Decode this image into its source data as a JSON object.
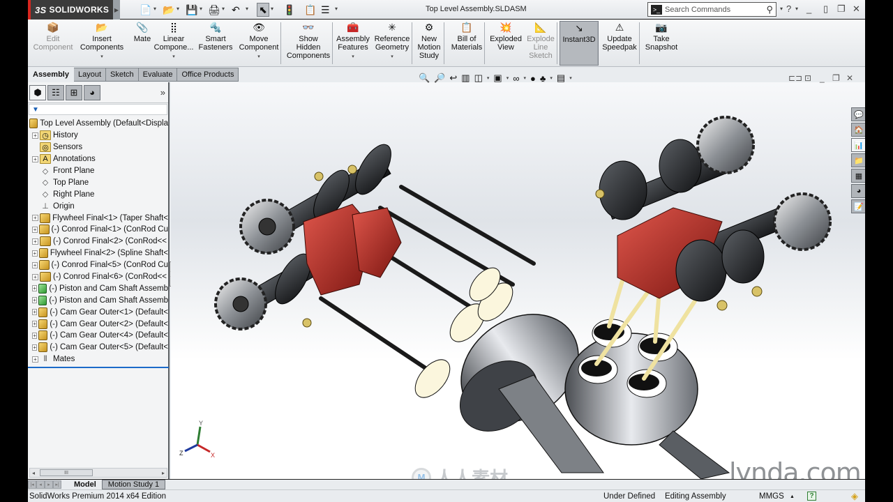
{
  "app": {
    "brand": "SOLIDWORKS",
    "document_title": "Top Level Assembly.SLDASM",
    "search": {
      "placeholder": "Search Commands"
    }
  },
  "quick_access": [
    {
      "name": "new-document",
      "icon": "📄"
    },
    {
      "name": "open-document",
      "icon": "📂"
    },
    {
      "name": "save",
      "icon": "💾"
    },
    {
      "name": "print",
      "icon": "🖨"
    },
    {
      "name": "undo",
      "icon": "↶"
    },
    {
      "name": "select",
      "icon": "⬉"
    },
    {
      "name": "rebuild",
      "icon": "🚦"
    },
    {
      "name": "file-properties",
      "icon": "📋"
    },
    {
      "name": "options",
      "icon": "☰"
    }
  ],
  "window_controls": {
    "help": "?",
    "minimize": "_",
    "tile": "▯",
    "restore": "❐",
    "close": "✕"
  },
  "command_manager": {
    "buttons": [
      {
        "id": "edit-component",
        "label": "Edit\nComponent",
        "icon": "📦",
        "disabled": true
      },
      {
        "id": "insert-components",
        "label": "Insert\nComponents",
        "icon": "📂",
        "dropdown": true
      },
      {
        "id": "mate",
        "label": "Mate",
        "icon": "📎"
      },
      {
        "id": "linear-component-pattern",
        "label": "Linear\nCompone...",
        "icon": "⣿",
        "dropdown": true
      },
      {
        "id": "smart-fasteners",
        "label": "Smart\nFasteners",
        "icon": "🔩"
      },
      {
        "id": "move-component",
        "label": "Move\nComponent",
        "icon": "👁",
        "dropdown": true
      },
      {
        "id": "show-hidden-components",
        "label": "Show\nHidden\nComponents",
        "icon": "👓"
      },
      {
        "id": "assembly-features",
        "label": "Assembly\nFeatures",
        "icon": "🧰",
        "dropdown": true
      },
      {
        "id": "reference-geometry",
        "label": "Reference\nGeometry",
        "icon": "✳",
        "dropdown": true
      },
      {
        "id": "new-motion-study",
        "label": "New\nMotion\nStudy",
        "icon": "⚙"
      },
      {
        "id": "bill-of-materials",
        "label": "Bill of\nMaterials",
        "icon": "📋"
      },
      {
        "id": "exploded-view",
        "label": "Exploded\nView",
        "icon": "💥"
      },
      {
        "id": "explode-line-sketch",
        "label": "Explode\nLine\nSketch",
        "icon": "📐",
        "disabled": true
      },
      {
        "id": "instant3d",
        "label": "Instant3D",
        "icon": "↘",
        "active": true
      },
      {
        "id": "update-speedpak",
        "label": "Update\nSpeedpak",
        "icon": "⚠"
      },
      {
        "id": "take-snapshot",
        "label": "Take\nSnapshot",
        "icon": "📷"
      }
    ],
    "tabs": [
      "Assembly",
      "Layout",
      "Sketch",
      "Evaluate",
      "Office Products"
    ],
    "active_tab": "Assembly"
  },
  "heads_up_toolbar": [
    {
      "name": "zoom-to-fit",
      "icon": "🔍"
    },
    {
      "name": "zoom-to-area",
      "icon": "🔎"
    },
    {
      "name": "previous-view",
      "icon": "↩"
    },
    {
      "name": "section-view",
      "icon": "▥"
    },
    {
      "name": "view-orientation",
      "icon": "◫",
      "dropdown": true
    },
    {
      "name": "display-style",
      "icon": "▣",
      "dropdown": true
    },
    {
      "name": "hide-show-items",
      "icon": "∞",
      "dropdown": true
    },
    {
      "name": "edit-appearance",
      "icon": "●"
    },
    {
      "name": "apply-scene",
      "icon": "♣",
      "dropdown": true
    },
    {
      "name": "view-settings",
      "icon": "▤",
      "dropdown": true
    }
  ],
  "feature_manager": {
    "tabs": [
      {
        "name": "featuremanager-tab",
        "icon": "⬢"
      },
      {
        "name": "propertymanager-tab",
        "icon": "☷"
      },
      {
        "name": "configurationmanager-tab",
        "icon": "⊞"
      },
      {
        "name": "displaymanager-tab",
        "icon": "◕"
      }
    ],
    "more": "»",
    "filter_icon": "▼",
    "tree": [
      {
        "label": "Top Level Assembly  (Default<Displa",
        "icon": "asm",
        "expander": false,
        "level": 0
      },
      {
        "label": "History",
        "icon": "history",
        "expander": true,
        "level": 1
      },
      {
        "label": "Sensors",
        "icon": "sensor",
        "expander": false,
        "level": 1
      },
      {
        "label": "Annotations",
        "icon": "annotation",
        "expander": true,
        "level": 1
      },
      {
        "label": "Front Plane",
        "icon": "plane",
        "expander": false,
        "level": 1
      },
      {
        "label": "Top Plane",
        "icon": "plane",
        "expander": false,
        "level": 1
      },
      {
        "label": "Right Plane",
        "icon": "plane",
        "expander": false,
        "level": 1
      },
      {
        "label": "Origin",
        "icon": "origin",
        "expander": false,
        "level": 1
      },
      {
        "label": "Flywheel Final<1> (Taper Shaft<",
        "icon": "asm",
        "expander": true,
        "level": 1
      },
      {
        "label": "(-) Conrod Final<1> (ConRod Cu",
        "icon": "asm",
        "expander": true,
        "level": 1
      },
      {
        "label": "(-) Conrod Final<2> (ConRod<<",
        "icon": "asm",
        "expander": true,
        "level": 1
      },
      {
        "label": "Flywheel Final<2> (Spline Shaft<",
        "icon": "asm",
        "expander": true,
        "level": 1
      },
      {
        "label": "(-) Conrod Final<5> (ConRod Cu",
        "icon": "asm",
        "expander": true,
        "level": 1
      },
      {
        "label": "(-) Conrod Final<6> (ConRod<<",
        "icon": "asm",
        "expander": true,
        "level": 1
      },
      {
        "label": "(-) Piston and Cam Shaft Assemb",
        "icon": "asm-green",
        "expander": true,
        "level": 1
      },
      {
        "label": "(-) Piston and Cam Shaft Assemb",
        "icon": "asm-green",
        "expander": true,
        "level": 1
      },
      {
        "label": "(-) Cam Gear Outer<1> (Default<",
        "icon": "asm",
        "expander": true,
        "level": 1
      },
      {
        "label": "(-) Cam Gear Outer<2> (Default<",
        "icon": "asm",
        "expander": true,
        "level": 1
      },
      {
        "label": "(-) Cam Gear Outer<4> (Default<",
        "icon": "asm",
        "expander": true,
        "level": 1
      },
      {
        "label": "(-) Cam Gear Outer<5> (Default<",
        "icon": "asm",
        "expander": true,
        "level": 1
      },
      {
        "label": "Mates",
        "icon": "mates",
        "expander": true,
        "level": 1
      }
    ],
    "hscroll_thumb": "III"
  },
  "task_pane": [
    {
      "name": "solidworks-resources",
      "icon": "💬"
    },
    {
      "name": "design-library",
      "icon": "🏠"
    },
    {
      "name": "file-explorer",
      "icon": "📊",
      "active": true
    },
    {
      "name": "view-palette",
      "icon": "📁"
    },
    {
      "name": "appearances-scenes",
      "icon": "▦"
    },
    {
      "name": "custom-properties",
      "icon": "◕"
    },
    {
      "name": "forum",
      "icon": "📝"
    }
  ],
  "triad": {
    "x": "X",
    "y": "Y",
    "z": "Z"
  },
  "bottom_tabs": [
    "Model",
    "Motion Study 1"
  ],
  "active_bottom_tab": "Model",
  "status_bar": {
    "app_edition": "SolidWorks Premium 2014 x64 Edition",
    "definition": "Under Defined",
    "mode": "Editing Assembly",
    "units": "MMGS",
    "units_dropdown": "▲",
    "help": "?",
    "rebuild": "◈"
  },
  "watermarks": {
    "lynda": "lynda.com",
    "cn": "人人素材"
  },
  "colors": {
    "accent_red": "#d7261f",
    "selection_blue": "#1b6ac9"
  }
}
